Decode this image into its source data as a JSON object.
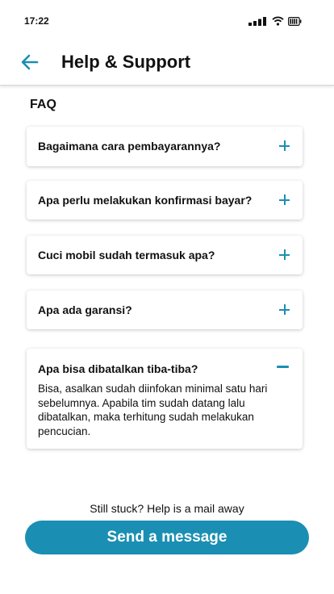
{
  "status_bar": {
    "time": "17:22",
    "icons": [
      "signal-icon",
      "wifi-icon",
      "battery-icon"
    ]
  },
  "header": {
    "back_icon": "arrow-left-icon",
    "title": "Help & Support"
  },
  "faq": {
    "heading": "FAQ",
    "items": [
      {
        "question": "Bagaimana cara pembayarannya?",
        "expanded": false
      },
      {
        "question": "Apa perlu melakukan konfirmasi bayar?",
        "expanded": false
      },
      {
        "question": "Cuci mobil sudah termasuk apa?",
        "expanded": false
      },
      {
        "question": "Apa ada garansi?",
        "expanded": false
      },
      {
        "question": "Apa bisa dibatalkan tiba-tiba?",
        "expanded": true,
        "answer": "Bisa, asalkan sudah diinfokan minimal satu hari sebelumnya. Apabila tim sudah datang lalu dibatalkan, maka terhitung sudah melakukan pencucian."
      }
    ]
  },
  "footer": {
    "help_text": "Still stuck? Help is a mail away",
    "send_label": "Send a message"
  },
  "colors": {
    "accent": "#1a8fb3"
  }
}
